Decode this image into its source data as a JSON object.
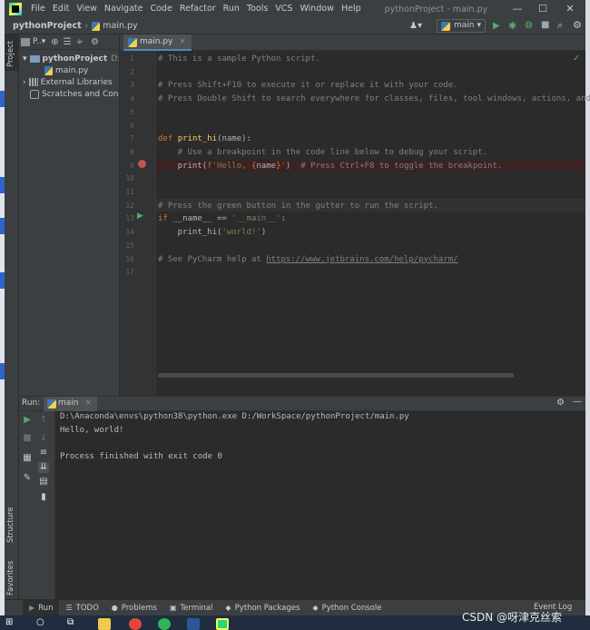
{
  "menu": [
    "File",
    "Edit",
    "View",
    "Navigate",
    "Code",
    "Refactor",
    "Run",
    "Tools",
    "VCS",
    "Window",
    "Help"
  ],
  "window_title": "pythonProject - main.py",
  "window_controls": {
    "minimize": "—",
    "maximize": "☐",
    "close": "✕"
  },
  "breadcrumb": {
    "project": "pythonProject",
    "separator": "›",
    "file": "main.py"
  },
  "run_config": {
    "label": "main"
  },
  "left_stripe": {
    "project": "Project",
    "structure": "Structure",
    "favorites": "Favorites"
  },
  "project_panel": {
    "dropdown": "P..▾",
    "tree": [
      {
        "label": "pythonProject",
        "path": "D:\\W"
      },
      {
        "label": "main.py"
      },
      {
        "label": "External Libraries"
      },
      {
        "label": "Scratches and Consol"
      }
    ]
  },
  "editor": {
    "tab": "main.py",
    "lines": [
      {
        "n": "1",
        "parts": [
          {
            "c": "cmt",
            "t": "# This is a sample Python script."
          }
        ]
      },
      {
        "n": "2",
        "parts": []
      },
      {
        "n": "3",
        "parts": [
          {
            "c": "cmt",
            "t": "# Press Shift+F10 to execute it or replace it with your code."
          }
        ]
      },
      {
        "n": "4",
        "parts": [
          {
            "c": "cmt",
            "t": "# Press Double Shift to search everywhere for classes, files, tool windows, actions, and settings."
          }
        ]
      },
      {
        "n": "5",
        "parts": []
      },
      {
        "n": "6",
        "parts": []
      },
      {
        "n": "7",
        "parts": [
          {
            "c": "kw",
            "t": "def "
          },
          {
            "c": "fn",
            "t": "print_hi"
          },
          {
            "c": "",
            "t": "(name):"
          }
        ]
      },
      {
        "n": "8",
        "parts": [
          {
            "c": "cmt",
            "t": "    # Use a breakpoint in the code line below to debug your script."
          }
        ]
      },
      {
        "n": "9",
        "parts": [
          {
            "c": "",
            "t": "    print("
          },
          {
            "c": "str",
            "t": "f'Hello, "
          },
          {
            "c": "kw",
            "t": "{"
          },
          {
            "c": "",
            "t": "name"
          },
          {
            "c": "kw",
            "t": "}"
          },
          {
            "c": "str",
            "t": "'"
          },
          {
            "c": "",
            "t": ")  "
          },
          {
            "c": "cmt",
            "t": "# Press Ctrl+F8 to toggle the breakpoint."
          }
        ]
      },
      {
        "n": "10",
        "parts": []
      },
      {
        "n": "11",
        "parts": []
      },
      {
        "n": "12",
        "parts": [
          {
            "c": "cmt",
            "t": "# Press the green button in the gutter to run the script."
          }
        ]
      },
      {
        "n": "13",
        "parts": [
          {
            "c": "kw",
            "t": "if "
          },
          {
            "c": "",
            "t": "__name__ == "
          },
          {
            "c": "str",
            "t": "'__main__'"
          },
          {
            "c": "",
            "t": ":"
          }
        ]
      },
      {
        "n": "14",
        "parts": [
          {
            "c": "",
            "t": "    print_hi("
          },
          {
            "c": "str",
            "t": "'world!'"
          },
          {
            "c": "",
            "t": ")"
          }
        ]
      },
      {
        "n": "15",
        "parts": []
      },
      {
        "n": "16",
        "parts": [
          {
            "c": "cmt",
            "t": "# See PyCharm help at "
          },
          {
            "c": "link",
            "t": "https://www.jetbrains.com/help/pycharm/"
          }
        ]
      },
      {
        "n": "17",
        "parts": []
      }
    ]
  },
  "run_panel": {
    "label": "Run:",
    "tab": "main",
    "output": [
      "D:\\Anaconda\\envs\\python38\\python.exe D:/WorkSpace/pythonProject/main.py",
      "Hello, world!",
      "",
      "Process finished with exit code 0"
    ]
  },
  "bottom_tabs": [
    {
      "icon": "▶",
      "label": "Run"
    },
    {
      "icon": "☰",
      "label": "TODO"
    },
    {
      "icon": "●",
      "label": "Problems"
    },
    {
      "icon": "▣",
      "label": "Terminal"
    },
    {
      "icon": "◆",
      "label": "Python Packages"
    },
    {
      "icon": "◆",
      "label": "Python Console"
    }
  ],
  "event_log": "Event Log",
  "watermark": "CSDN @呀津克丝索",
  "colors": {
    "accent": "#4a88c7",
    "breakpoint": "#c75450",
    "run_green": "#59a869"
  }
}
